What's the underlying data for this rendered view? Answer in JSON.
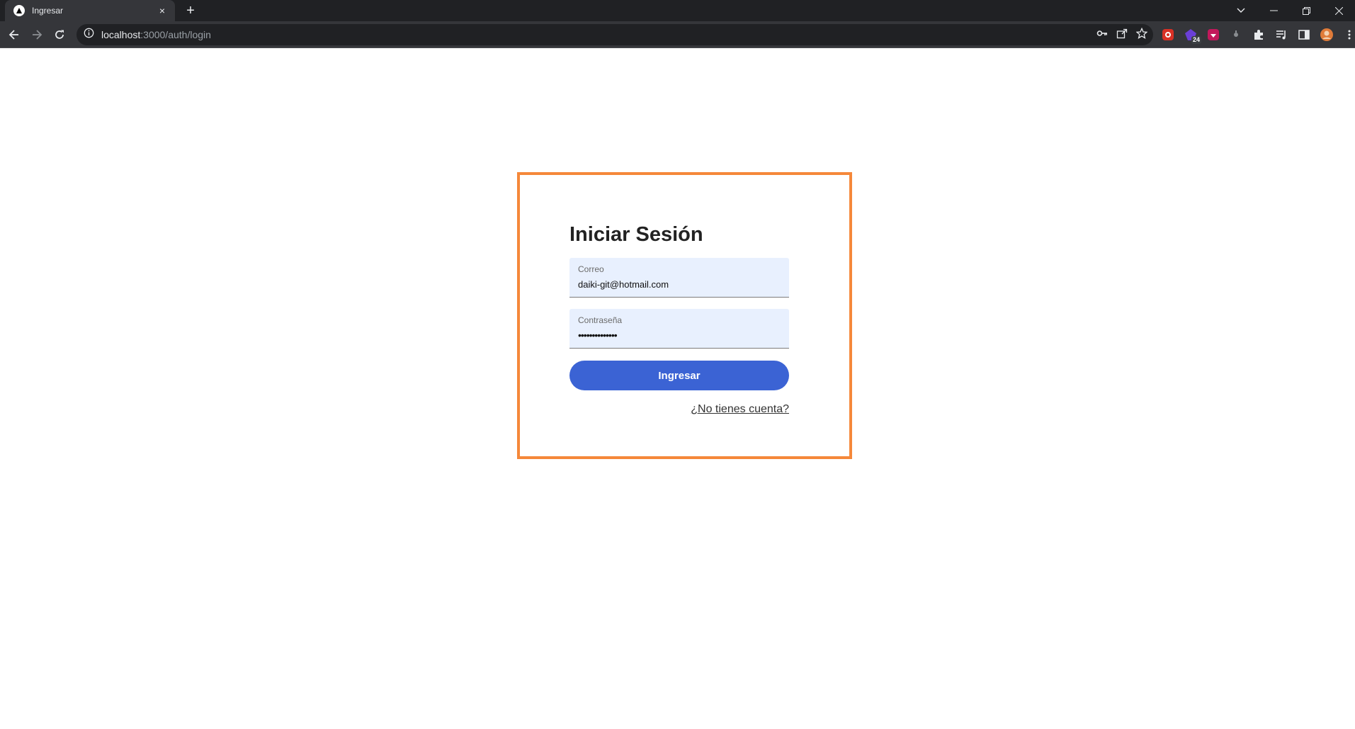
{
  "browser": {
    "tab": {
      "title": "Ingresar",
      "close_icon": "×"
    },
    "new_tab_icon": "+",
    "window_controls": {
      "minimize": "─",
      "restore": "❐",
      "close": "✕"
    },
    "address_bar": {
      "host": "localhost",
      "path": ":3000/auth/login"
    },
    "extensions": {
      "badge_count": "24"
    }
  },
  "login": {
    "title": "Iniciar Sesión",
    "email": {
      "label": "Correo",
      "value": "daiki-git@hotmail.com"
    },
    "password": {
      "label": "Contraseña",
      "value": "••••••••••••••"
    },
    "submit_label": "Ingresar",
    "register_link": "¿No tienes cuenta?"
  },
  "colors": {
    "card_border": "#f5883a",
    "button_bg": "#3b63d4",
    "field_bg": "#e8f0fe"
  }
}
